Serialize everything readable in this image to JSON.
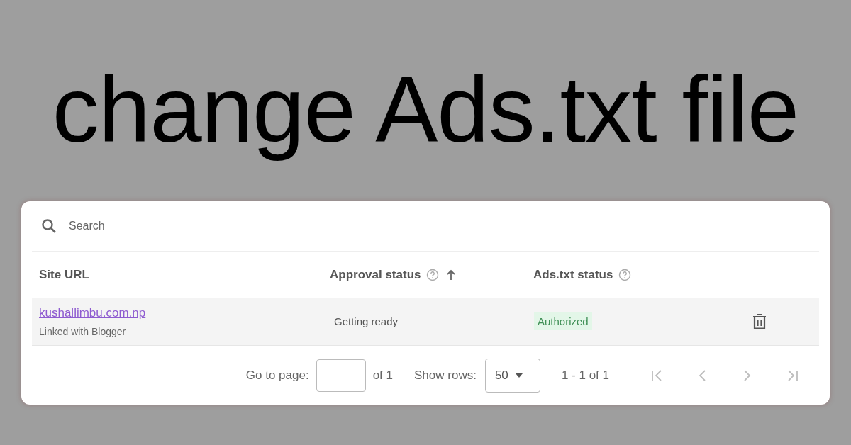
{
  "headline": "change Ads.txt file",
  "search": {
    "placeholder": "Search"
  },
  "table": {
    "columns": [
      {
        "label": "Site URL",
        "help": false,
        "sorted": false
      },
      {
        "label": "Approval status",
        "help": true,
        "sorted": true
      },
      {
        "label": "Ads.txt status",
        "help": true,
        "sorted": false
      }
    ],
    "rows": [
      {
        "site": "kushallimbu.com.np",
        "note": "Linked with Blogger",
        "approval": "Getting ready",
        "ads_txt": {
          "label": "Authorized",
          "color": "#e3f6e8"
        }
      }
    ]
  },
  "pagination": {
    "go_to_label": "Go to page:",
    "of_pages": "of 1",
    "rows_label": "Show rows:",
    "rows_value": "50",
    "range": "1 - 1 of 1",
    "buttons": [
      {
        "kind": "first",
        "disabled": true
      },
      {
        "kind": "prev",
        "disabled": true
      },
      {
        "kind": "next",
        "disabled": true
      },
      {
        "kind": "last",
        "disabled": true
      }
    ]
  }
}
